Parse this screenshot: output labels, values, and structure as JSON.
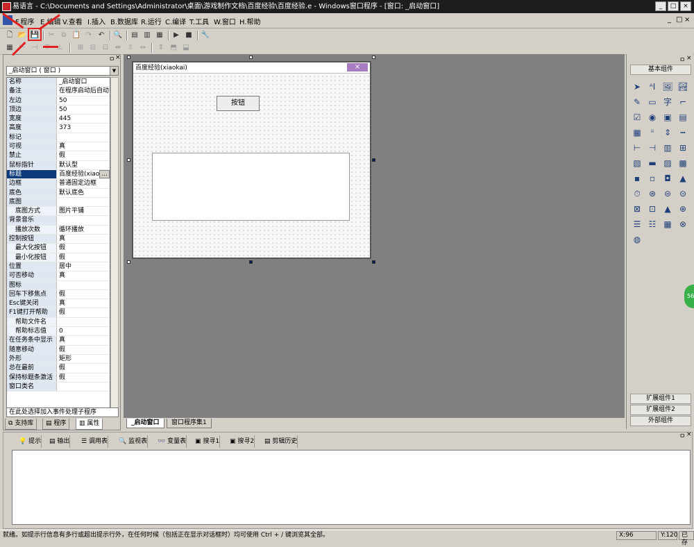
{
  "window": {
    "title": "易语言 - C:\\Documents and Settings\\Administrator\\桌面\\游戏制作文档\\百度经验\\百度经验.e - Windows窗口程序 - [窗口: _启动窗口]",
    "minimize": "_",
    "maximize": "□",
    "close": "×"
  },
  "menubar": {
    "items": [
      "F.程序",
      "E.编辑",
      "V.查看",
      "I.插入",
      "B.数据库",
      "R.运行",
      "C.编译",
      "T.工具",
      "W.窗口",
      "H.帮助"
    ],
    "mdi_min": "_",
    "mdi_max": "□",
    "mdi_close": "×"
  },
  "toolbar1": {
    "new": "🗋",
    "open": "📂",
    "save": "💾",
    "cut": "✂",
    "copy": "⧉",
    "paste": "📋",
    "redo": "↷",
    "undo": "↶",
    "find": "🔍",
    "layout1": "▤",
    "layout2": "▥",
    "layout3": "▦",
    "run": "▶",
    "stop": "■",
    "compile": "🔧"
  },
  "left_panel": {
    "pin": "ㅁ",
    "close": "×",
    "object_select": "_启动窗口 ( 窗口 )",
    "event_select": "在此处选择加入事件处理子程序",
    "tabs": [
      "支持库",
      "程序",
      "属性"
    ],
    "properties": [
      {
        "name": "名称",
        "value": "_启动窗口",
        "sub": false
      },
      {
        "name": "备注",
        "value": "在程序启动后自动",
        "sub": false
      },
      {
        "name": "左边",
        "value": "50",
        "sub": false
      },
      {
        "name": "顶边",
        "value": "50",
        "sub": false
      },
      {
        "name": "宽度",
        "value": "445",
        "sub": false
      },
      {
        "name": "高度",
        "value": "373",
        "sub": false
      },
      {
        "name": "标记",
        "value": "",
        "sub": false
      },
      {
        "name": "可视",
        "value": "真",
        "sub": false
      },
      {
        "name": "禁止",
        "value": "假",
        "sub": false
      },
      {
        "name": "鼠标指针",
        "value": "默认型",
        "sub": false
      },
      {
        "name": "标题",
        "value": "百度经验(xiao",
        "sub": false,
        "selected": true
      },
      {
        "name": "边框",
        "value": "普通固定边框",
        "sub": false
      },
      {
        "name": "底色",
        "value": "默认底色",
        "sub": false
      },
      {
        "name": "底图",
        "value": "",
        "sub": false
      },
      {
        "name": "底图方式",
        "value": "图片平铺",
        "sub": true
      },
      {
        "name": "背景音乐",
        "value": "",
        "sub": false
      },
      {
        "name": "播放次数",
        "value": "循环播放",
        "sub": true
      },
      {
        "name": "控制按钮",
        "value": "真",
        "sub": false
      },
      {
        "name": "最大化按钮",
        "value": "假",
        "sub": true
      },
      {
        "name": "最小化按钮",
        "value": "假",
        "sub": true
      },
      {
        "name": "位置",
        "value": "居中",
        "sub": false
      },
      {
        "name": "可否移动",
        "value": "真",
        "sub": false
      },
      {
        "name": "图标",
        "value": "",
        "sub": false
      },
      {
        "name": "回车下移焦点",
        "value": "假",
        "sub": false
      },
      {
        "name": "Esc键关闭",
        "value": "真",
        "sub": false
      },
      {
        "name": "F1键打开帮助",
        "value": "假",
        "sub": false
      },
      {
        "name": "帮助文件名",
        "value": "",
        "sub": true
      },
      {
        "name": "帮助标志值",
        "value": "0",
        "sub": true
      },
      {
        "name": "在任务条中显示",
        "value": "真",
        "sub": false
      },
      {
        "name": "随意移动",
        "value": "假",
        "sub": false
      },
      {
        "name": "外形",
        "value": "矩形",
        "sub": false
      },
      {
        "name": "总在最前",
        "value": "假",
        "sub": false
      },
      {
        "name": "保持标题条激活",
        "value": "假",
        "sub": false
      },
      {
        "name": "窗口类名",
        "value": "",
        "sub": false
      }
    ]
  },
  "designer": {
    "form_title": "百度经验(xiaokai)",
    "form_close": "×",
    "button_label": "按钮",
    "doc_tabs": [
      "_启动窗口",
      "窗口程序集1"
    ]
  },
  "right_panel": {
    "pin": "ㅁ",
    "close": "×",
    "header": "基本组件",
    "footer_buttons": [
      "扩展组件1",
      "扩展组件2",
      "外部组件"
    ],
    "green_label": "56"
  },
  "bottom_panel": {
    "pin": "ㅁ",
    "close": "×",
    "tabs": [
      "提示",
      "输出",
      "调用表",
      "监视表",
      "变量表",
      "搜寻1",
      "搜寻2",
      "剪辑历史"
    ]
  },
  "statusbar": {
    "text": "就绪。如提示行信息有多行或超出提示行外，在任何时候（包括正在显示对话框时）均可使用 Ctrl + / 键浏览其全部。",
    "x": "X:96",
    "y": "Y:120",
    "state": "已存"
  },
  "colors": {
    "annotation": "#e02020",
    "selected_row": "#0a3a7a",
    "titlebar": "#1d1d1d"
  }
}
